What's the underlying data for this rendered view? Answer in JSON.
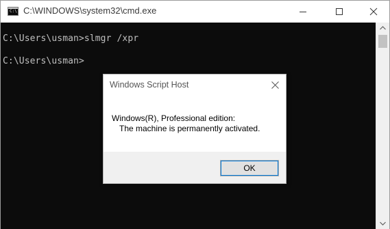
{
  "window": {
    "title": "C:\\WINDOWS\\system32\\cmd.exe",
    "icon_text": "C:\\",
    "icons": {
      "app": "cmd-app-icon",
      "minimize": "minimize-icon",
      "maximize": "maximize-icon",
      "close": "close-icon"
    }
  },
  "console": {
    "lines": [
      "C:\\Users\\usman>slmgr /xpr",
      "C:\\Users\\usman>"
    ],
    "background": "#0c0c0c",
    "foreground": "#c0c0c0"
  },
  "scrollbar": {
    "icons": {
      "up": "scroll-up-arrow-icon",
      "down": "scroll-down-arrow-icon"
    }
  },
  "dialog": {
    "title": "Windows Script Host",
    "message_line1": "Windows(R), Professional edition:",
    "message_line2": "The machine is permanently activated.",
    "ok_label": "OK",
    "icons": {
      "close": "dialog-close-icon"
    },
    "accent": "#0078d7"
  }
}
